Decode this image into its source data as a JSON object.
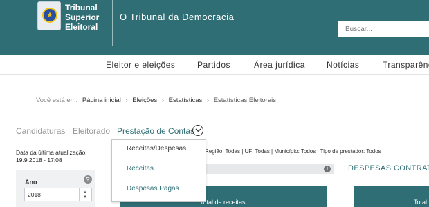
{
  "header": {
    "logo_lines": [
      "Tribunal",
      "Superior",
      "Eleitoral"
    ],
    "tagline": "O Tribunal da Democracia",
    "search_placeholder": "Buscar..."
  },
  "nav": {
    "items": [
      {
        "label": "Eleitor e eleições"
      },
      {
        "label": "Partidos"
      },
      {
        "label": "Área jurídica"
      },
      {
        "label": "Notícias"
      },
      {
        "label": "Transparênc"
      }
    ]
  },
  "breadcrumb": {
    "prefix": "Você está em:",
    "items": [
      "Página inicial",
      "Eleições",
      "Estatísticas",
      "Estatísticas Eleitorais"
    ]
  },
  "tabs": {
    "items": [
      {
        "label": "Candidaturas"
      },
      {
        "label": "Eleitorado"
      },
      {
        "label": "Prestação de Contas"
      }
    ]
  },
  "dropdown": {
    "items": [
      "Receitas/Despesas",
      "Receitas",
      "Despesas Pagas"
    ]
  },
  "sidebar": {
    "updated_label": "Data da última atualização:",
    "updated_value": "19.9.2018 - 17:08",
    "year_label": "Ano",
    "year_value": "2018"
  },
  "filters_summary": "Região: Todas  |  UF: Todas  |  Município: Todos  |  Tipo de prestador: Todos",
  "content": {
    "section_title": "DESPESAS CONTRATA",
    "card_left_title": "Total de receitas",
    "card_right_title": "Total"
  },
  "colors": {
    "brand": "#2f6e74",
    "header_bg": "#2f6e74",
    "muted_tab": "#999999"
  }
}
